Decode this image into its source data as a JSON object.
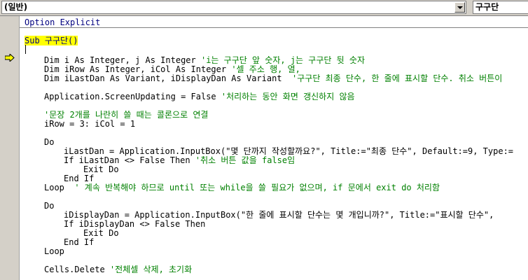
{
  "object_combo": {
    "value": "(일반)"
  },
  "procedure_combo": {
    "value": "구구단"
  },
  "code": {
    "lines": [
      {
        "text": "Option Explicit",
        "kind": "kw"
      },
      {
        "text": "Sub 구구단()",
        "kind": "kw-hl"
      },
      {
        "c": "Dim i As Integer, j As Integer ",
        "m": "'i는 구구단 앞 숫자, j는 구구단 뒷 숫자"
      },
      {
        "c": "Dim iRow As Integer, iCol As Integer ",
        "m": "'셀 주소 행, 열,"
      },
      {
        "c": "Dim iLastDan As Variant, iDisplayDan As Variant  ",
        "m": "'구구단 최종 단수, 한 줄에 표시할 단수. 취소 버튼이"
      },
      {
        "c": "Application.ScreenUpdating = False ",
        "m": "'처리하는 동안 화면 갱신하지 않음"
      },
      {
        "m": "'문장 2개를 나란히 쓸 때는 콜론으로 연결"
      },
      {
        "c": "iRow = 3: iCol = 1"
      },
      {
        "c": "Do"
      },
      {
        "c": "iLastDan = Application.InputBox(\"몇 단까지 작성할까요?\", Title:=\"최종 단수\", Default:=9, Type:="
      },
      {
        "c": "If iLastDan <> False Then ",
        "m": "'취소 버튼 값을 false임"
      },
      {
        "c": "Exit Do"
      },
      {
        "c": "End If"
      },
      {
        "c": "Loop  ",
        "m": "' 계속 반복해야 하므로 until 또는 while을 쓸 필요가 없으며, if 문에서 exit do 처리함"
      },
      {
        "c": "Do"
      },
      {
        "c": "iDisplayDan = Application.InputBox(\"한 줄에 표시할 단수는 몇 개입니까?\", Title:=\"표시할 단수\","
      },
      {
        "c": "If iDisplayDan <> False Then"
      },
      {
        "c": "Exit Do"
      },
      {
        "c": "End If"
      },
      {
        "c": "Loop"
      },
      {
        "c": "Cells.Delete ",
        "m": "'전체셀 삭제, 초기화"
      }
    ]
  },
  "colors": {
    "keyword": "#00007f",
    "comment": "#008000",
    "highlight": "#ffff00",
    "toolbar": "#d4d0c8"
  },
  "icons": {
    "execution_pointer": "arrow-right-icon",
    "dropdown": "chevron-down-icon"
  }
}
